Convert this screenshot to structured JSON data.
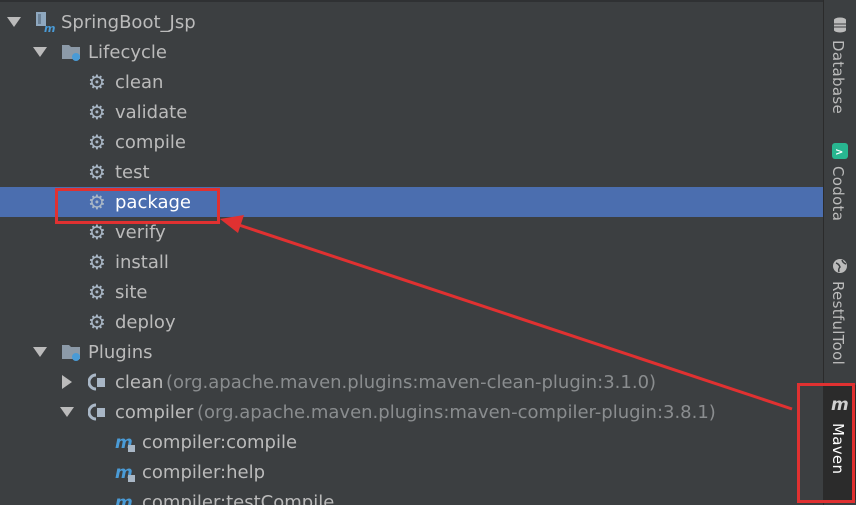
{
  "tree": {
    "project": "SpringBoot_Jsp",
    "lifecycle": {
      "label": "Lifecycle",
      "items": [
        "clean",
        "validate",
        "compile",
        "test",
        "package",
        "verify",
        "install",
        "site",
        "deploy"
      ]
    },
    "plugins": {
      "label": "Plugins",
      "items": [
        {
          "name": "clean",
          "detail": "(org.apache.maven.plugins:maven-clean-plugin:3.1.0)"
        },
        {
          "name": "compiler",
          "detail": "(org.apache.maven.plugins:maven-compiler-plugin:3.8.1)"
        }
      ],
      "compiler_goals": [
        "compiler:compile",
        "compiler:help",
        "compiler:testCompile"
      ]
    }
  },
  "sidebar": {
    "tabs": [
      "Database",
      "Codota",
      "RestfulTool",
      "Maven"
    ]
  },
  "colors": {
    "background": "#3c3f41",
    "selection": "#4b6eaf",
    "annotation": "#e03131",
    "gear": "#a9b7c6",
    "maven_icon": "#4a9bd6"
  },
  "icons": {
    "project": "maven-module-icon",
    "folder": "folder-icon",
    "goal": "gear-icon",
    "plugin": "plugin-icon",
    "plugin_goal": "maven-goal-icon"
  }
}
